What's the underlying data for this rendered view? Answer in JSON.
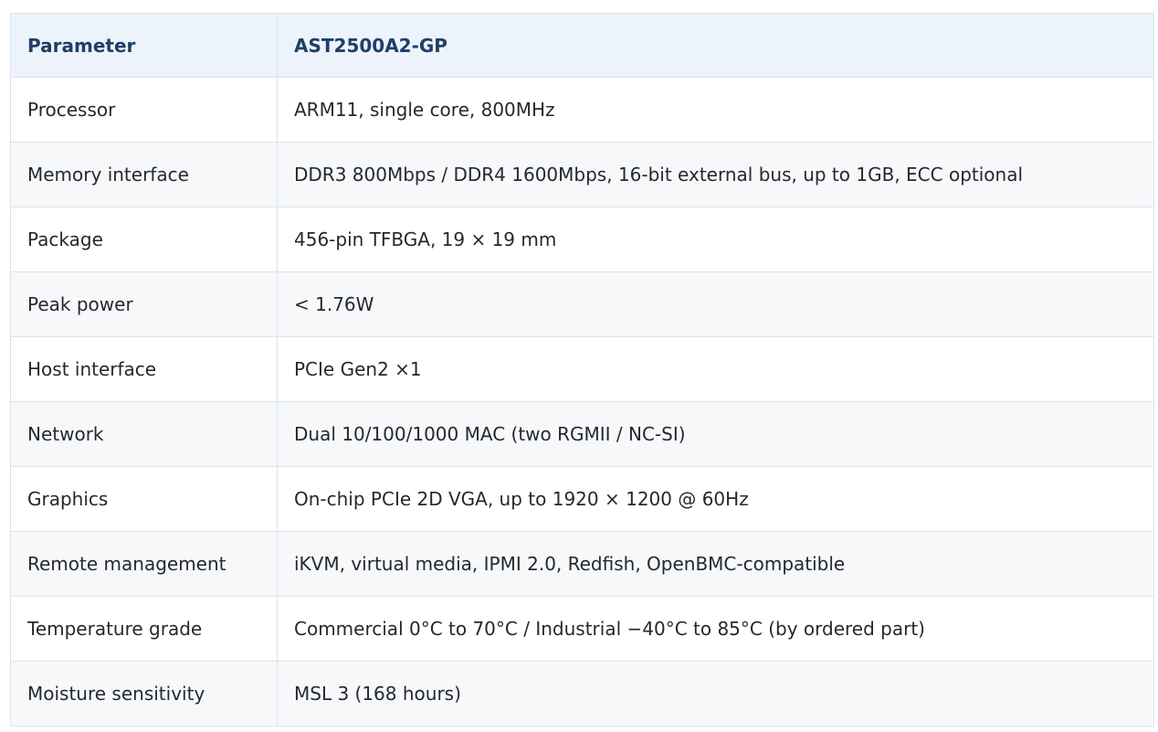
{
  "table": {
    "headers": [
      "Parameter",
      "AST2500A2-GP"
    ],
    "rows": [
      [
        "Processor",
        "ARM11, single core, 800MHz"
      ],
      [
        "Memory interface",
        "DDR3 800Mbps / DDR4 1600Mbps, 16-bit external bus, up to 1GB, ECC optional"
      ],
      [
        "Package",
        "456-pin TFBGA, 19 × 19 mm"
      ],
      [
        "Peak power",
        "< 1.76W"
      ],
      [
        "Host interface",
        "PCIe Gen2 ×1"
      ],
      [
        "Network",
        "Dual 10/100/1000 MAC (two RGMII / NC-SI)"
      ],
      [
        "Graphics",
        "On-chip PCIe 2D VGA, up to 1920 × 1200 @ 60Hz"
      ],
      [
        "Remote management",
        "iKVM, virtual media, IPMI 2.0, Redfish, OpenBMC-compatible"
      ],
      [
        "Temperature grade",
        "Commercial 0°C to 70°C / Industrial −40°C to 85°C (by ordered part)"
      ],
      [
        "Moisture sensitivity",
        "MSL 3 (168 hours)"
      ]
    ]
  }
}
